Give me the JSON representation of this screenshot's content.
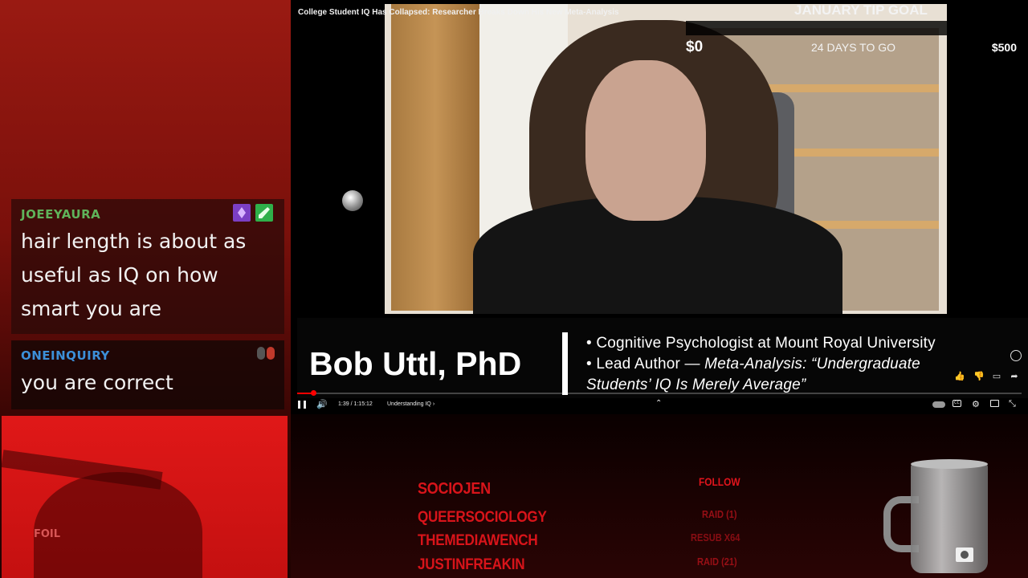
{
  "video": {
    "title": "College Student IQ Has Collapsed: Researcher Breaks Down His New Meta-Analysis",
    "goal": {
      "title": "JANUARY TIP GOAL",
      "min": "$0",
      "days": "24 DAYS TO GO",
      "max": "$500",
      "progress_fraction": 0
    },
    "lower_third": {
      "name": "Bob Uttl, PhD",
      "line1": "• Cognitive Psychologist at Mount Royal University",
      "line2_prefix": "• Lead Author — ",
      "line2_italic": "Meta-Analysis: “Undergraduate",
      "line3": "Students’ IQ Is Merely Average”"
    },
    "player": {
      "time": "1:39 / 1:15:12",
      "chapter": "Understanding IQ",
      "progress_fraction": 0.022,
      "pause_icon": "pause-icon",
      "volume_icon": "volume-icon"
    }
  },
  "chat": [
    {
      "user": "JOEEYAURA",
      "message": "hair length is about as useful as IQ on how smart you are",
      "user_color": "#5fb35a"
    },
    {
      "user": "ONEINQUIRY",
      "message": "you are correct",
      "user_color": "#3c8fd8"
    }
  ],
  "webcam": {
    "overlay_text": "FOIL"
  },
  "recent": {
    "names": [
      "SOCIOJEN",
      "QUEERSOCIOLOGY",
      "THEMEDIAWENCH",
      "JUSTINFREAKIN"
    ],
    "events": [
      "FOLLOW",
      "RAID (1)",
      "RESUB X64",
      "RAID (21)"
    ]
  },
  "colors": {
    "accent_red": "#d8141a",
    "progress_red": "#ff0000"
  }
}
